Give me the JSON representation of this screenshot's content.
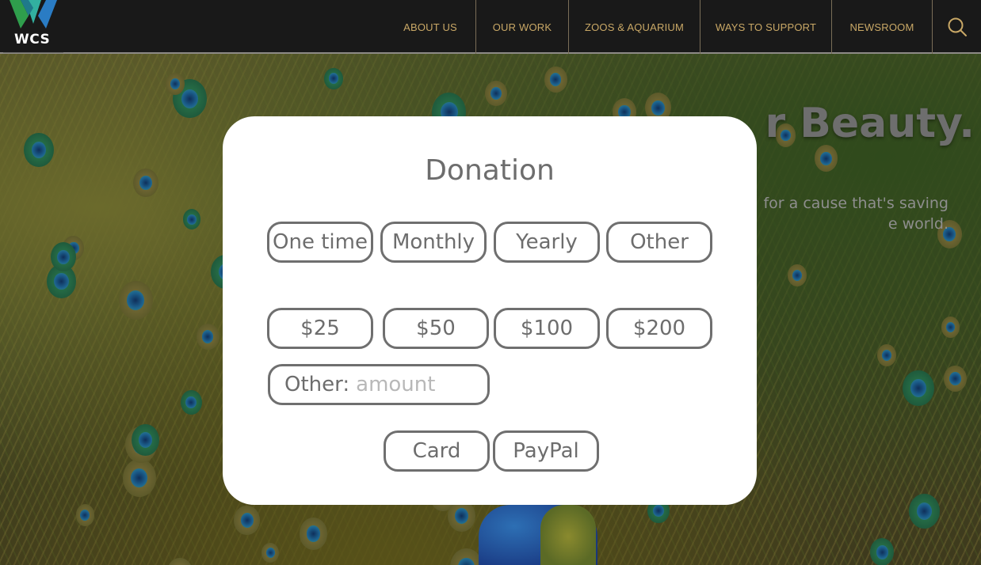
{
  "header": {
    "logo_text": "WCS",
    "nav_items": [
      "ABOUT US",
      "OUR WORK",
      "ZOOS & AQUARIUM",
      "WAYS TO SUPPORT",
      "NEWSROOM"
    ]
  },
  "hero": {
    "title_fragment": "r Beauty.",
    "subtitle_line1": "for a cause that's saving",
    "subtitle_line2": "e world."
  },
  "donation": {
    "title": "Donation",
    "frequency_options": [
      "One time",
      "Monthly",
      "Yearly",
      "Other"
    ],
    "amount_options": [
      "$25",
      "$50",
      "$100",
      "$200"
    ],
    "other_label": "Other:",
    "other_placeholder": "amount",
    "payment_options": [
      "Card",
      "PayPal"
    ]
  },
  "colors": {
    "nav_background": "#191919",
    "nav_text": "#c9a866",
    "logo_green": "#2f9e4c",
    "logo_blue": "#2a7cc4",
    "modal_border": "#6f6f6f"
  }
}
